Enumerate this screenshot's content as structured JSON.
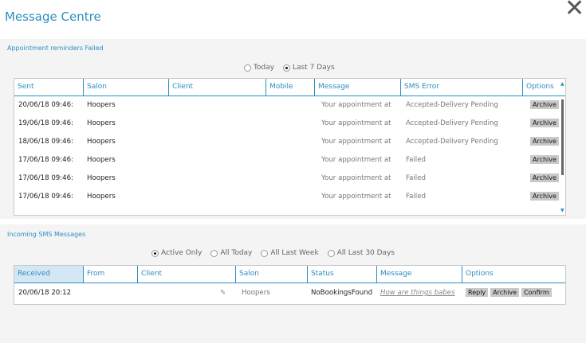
{
  "title": "Message Centre",
  "reminders": {
    "section_title": "Appointment reminders Failed",
    "filters": [
      {
        "label": "Today",
        "selected": false
      },
      {
        "label": "Last 7 Days",
        "selected": true
      }
    ],
    "columns": [
      "Sent",
      "Salon",
      "Client",
      "Mobile",
      "Message",
      "SMS Error",
      "Options"
    ],
    "rows": [
      {
        "sent": "20/06/18 09:46:",
        "salon": "Hoopers",
        "client": "",
        "mobile": "",
        "message": "Your appointment at",
        "error": "Accepted-Delivery Pending",
        "option": "Archive"
      },
      {
        "sent": "19/06/18 09:46:",
        "salon": "Hoopers",
        "client": "",
        "mobile": "",
        "message": "Your appointment at",
        "error": "Accepted-Delivery Pending",
        "option": "Archive"
      },
      {
        "sent": "18/06/18 09:46:",
        "salon": "Hoopers",
        "client": "",
        "mobile": "",
        "message": "Your appointment at",
        "error": "Accepted-Delivery Pending",
        "option": "Archive"
      },
      {
        "sent": "17/06/18 09:46:",
        "salon": "Hoopers",
        "client": "",
        "mobile": "",
        "message": "Your appointment at",
        "error": "Failed",
        "option": "Archive"
      },
      {
        "sent": "17/06/18 09:46:",
        "salon": "Hoopers",
        "client": "",
        "mobile": "",
        "message": "Your appointment at",
        "error": "Failed",
        "option": "Archive"
      },
      {
        "sent": "17/06/18 09:46:",
        "salon": "Hoopers",
        "client": "",
        "mobile": "",
        "message": "Your appointment at",
        "error": "Failed",
        "option": "Archive"
      }
    ]
  },
  "incoming": {
    "section_title": "Incoming SMS Messages",
    "filters": [
      {
        "label": "Active Only",
        "selected": true
      },
      {
        "label": "All Today",
        "selected": false
      },
      {
        "label": "All Last Week",
        "selected": false
      },
      {
        "label": "All Last 30 Days",
        "selected": false
      }
    ],
    "columns": [
      "Received",
      "From",
      "Client",
      "Salon",
      "Status",
      "Message",
      "Options"
    ],
    "rows": [
      {
        "received": "20/06/18 20:12",
        "from": "",
        "client": "",
        "salon": "Hoopers",
        "status": "NoBookingsFound",
        "message": "How are things babes",
        "options": [
          "Reply",
          "Archive",
          "Confirm"
        ]
      }
    ]
  },
  "colors": {
    "accent": "#2b8fc0",
    "panel": "#f4f4f4",
    "button": "#c9c9c9"
  },
  "icons": {
    "close": "close-icon",
    "edit": "pencil-icon"
  }
}
